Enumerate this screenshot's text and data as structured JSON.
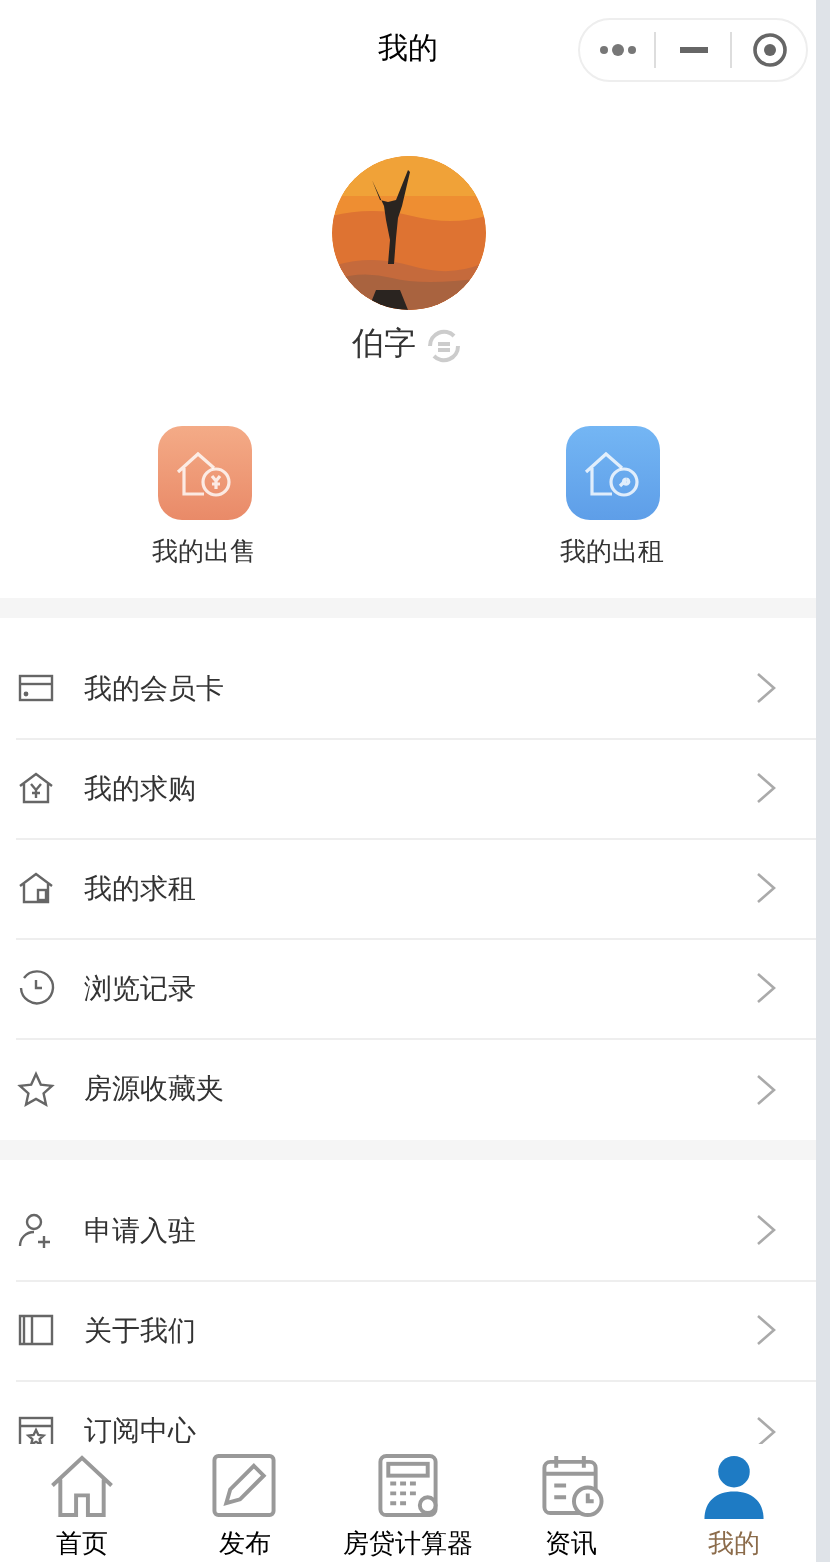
{
  "nav_bar": {
    "title": "我的"
  },
  "profile": {
    "name": "伯字"
  },
  "quick_actions": [
    {
      "kind": "sale",
      "label": "我的出售"
    },
    {
      "kind": "rent",
      "label": "我的出租"
    }
  ],
  "menu_groups": [
    [
      {
        "kind": "card",
        "label": "我的会员卡"
      },
      {
        "kind": "want-buy",
        "label": "我的求购"
      },
      {
        "kind": "want-rent",
        "label": "我的求租"
      },
      {
        "kind": "history",
        "label": "浏览记录"
      },
      {
        "kind": "favorites",
        "label": "房源收藏夹"
      }
    ],
    [
      {
        "kind": "apply",
        "label": "申请入驻"
      },
      {
        "kind": "about",
        "label": "关于我们"
      },
      {
        "kind": "subscribe",
        "label": "订阅中心"
      }
    ]
  ],
  "tab_bar": [
    {
      "kind": "home",
      "label": "首页",
      "selected": false
    },
    {
      "kind": "publish",
      "label": "发布",
      "selected": false
    },
    {
      "kind": "calculator",
      "label": "房贷计算器",
      "selected": false
    },
    {
      "kind": "news",
      "label": "资讯",
      "selected": false
    },
    {
      "kind": "me",
      "label": "我的",
      "selected": true
    }
  ]
}
